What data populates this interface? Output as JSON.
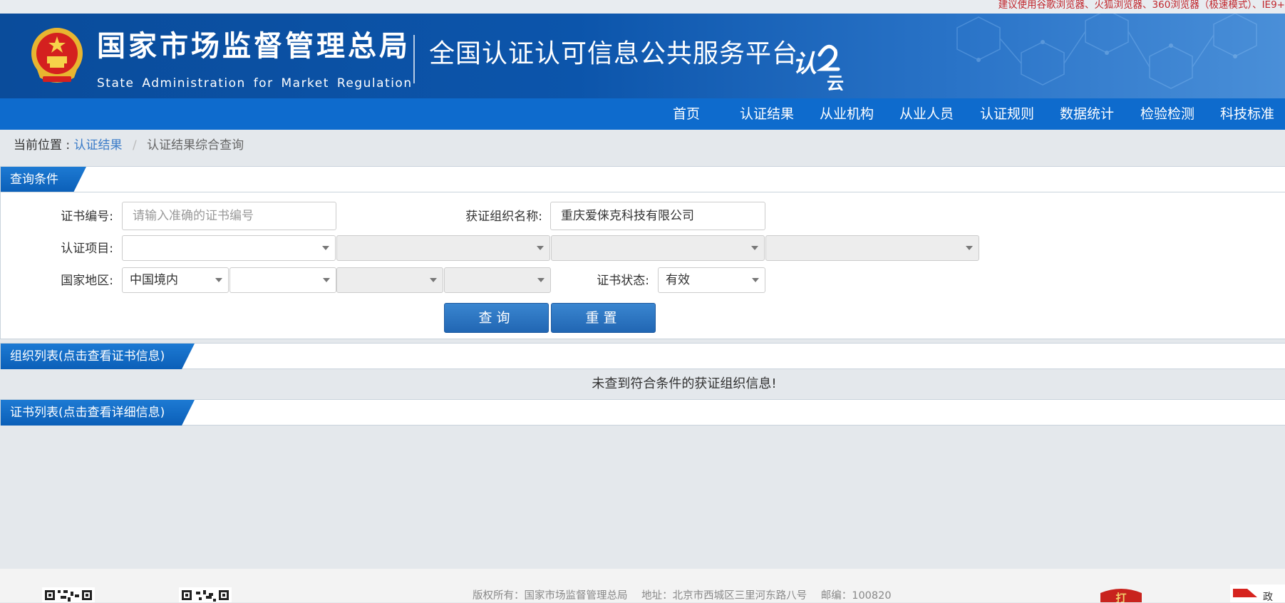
{
  "browser_notice": "建议使用谷歌浏览器、火狐浏览器、360浏览器（极速模式）、IE9+",
  "header": {
    "agency_cn": "国家市场监督管理总局",
    "agency_en": "State Administration  for  Market Regulation",
    "platform_title": "全国认证认可信息公共服务平台",
    "cloud_logo_text_1": "认",
    "cloud_logo_text_2": "云"
  },
  "nav": {
    "items": [
      "首页",
      "认证结果",
      "从业机构",
      "从业人员",
      "认证规则",
      "数据统计",
      "检验检测",
      "科技标准"
    ]
  },
  "breadcrumb": {
    "prefix": "当前位置 :",
    "parent": "认证结果",
    "separator": "/",
    "current": "认证结果综合查询"
  },
  "query_panel": {
    "title": "查询条件",
    "cert_no_label": "证书编号:",
    "cert_no_placeholder": "请输入准确的证书编号",
    "org_name_label": "获证组织名称:",
    "org_name_value": "重庆爱俫克科技有限公司",
    "project_label": "认证项目:",
    "region_label": "国家地区:",
    "region_value": "中国境内",
    "status_label": "证书状态:",
    "status_value": "有效",
    "search_button": "查询",
    "reset_button": "重置"
  },
  "org_list": {
    "title": "组织列表(点击查看证书信息)",
    "empty_message": "未查到符合条件的获证组织信息!"
  },
  "cert_list": {
    "title": "证书列表(点击查看详细信息)"
  },
  "footer": {
    "copyright": "版权所有：国家市场监督管理总局",
    "address": "地址：北京市西城区三里河东路八号",
    "postcode": "邮编：100820",
    "seal_char": "打",
    "partner_char": "政"
  },
  "colors": {
    "banner_blue": "#0c55ab",
    "nav_blue": "#0e6bcd",
    "button_blue": "#2a74c0",
    "link_blue": "#3a7bc8",
    "notice_red": "#c1272d"
  }
}
